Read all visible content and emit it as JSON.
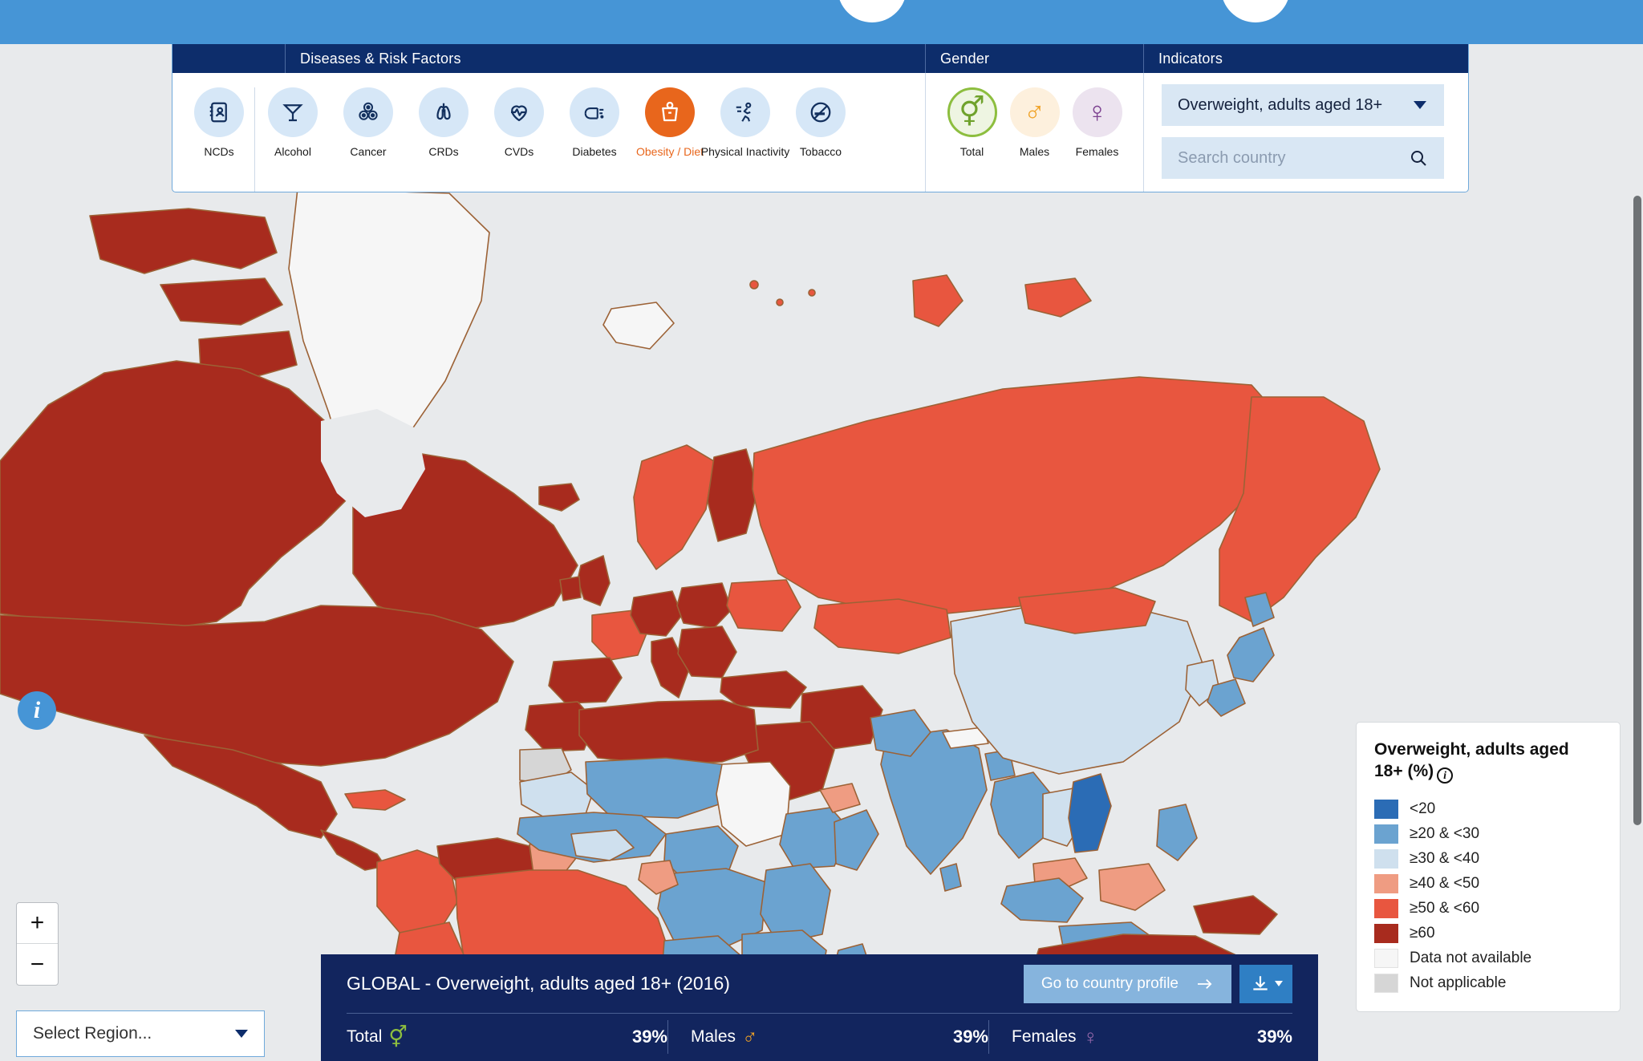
{
  "header": {
    "circles": [
      "nav-circle-left",
      "nav-circle-right"
    ]
  },
  "toolbar": {
    "sections": {
      "diseases_title": "Diseases & Risk Factors",
      "gender_title": "Gender",
      "indicators_title": "Indicators"
    },
    "ncds": {
      "label": "NCDs",
      "icon": "ncds-report-icon",
      "active": false
    },
    "risk_factors": [
      {
        "label": "Alcohol",
        "icon": "cocktail-glass-icon",
        "active": false
      },
      {
        "label": "Cancer",
        "icon": "cancer-cells-icon",
        "active": false
      },
      {
        "label": "CRDs",
        "icon": "lungs-icon",
        "active": false
      },
      {
        "label": "CVDs",
        "icon": "heart-pulse-icon",
        "active": false
      },
      {
        "label": "Diabetes",
        "icon": "finger-prick-icon",
        "active": false
      },
      {
        "label": "Obesity / Diet",
        "icon": "weight-scale-icon",
        "active": true
      },
      {
        "label": "Physical Inactivity",
        "icon": "running-person-icon",
        "active": false
      },
      {
        "label": "Tobacco",
        "icon": "no-smoking-icon",
        "active": false
      }
    ],
    "genders": [
      {
        "label": "Total",
        "icon": "total-gender-icon",
        "glyph": "⚥",
        "active": true
      },
      {
        "label": "Males",
        "icon": "male-gender-icon",
        "glyph": "♂",
        "active": false
      },
      {
        "label": "Females",
        "icon": "female-gender-icon",
        "glyph": "♀",
        "active": false
      }
    ],
    "indicator_select": {
      "value": "Overweight, adults aged 18+",
      "icon": "chevron-down-icon"
    },
    "country_search": {
      "placeholder": "Search country",
      "value": "",
      "icon": "search-icon"
    }
  },
  "map_controls": {
    "info_button": {
      "label": "i",
      "icon": "info-icon"
    },
    "zoom_in": "+",
    "zoom_out": "−",
    "region_select": {
      "value": "Select Region...",
      "icon": "chevron-down-icon"
    }
  },
  "bottom_panel": {
    "title": "GLOBAL - Overweight, adults aged 18+ (2016)",
    "profile_button": {
      "label": "Go to country profile",
      "icon": "arrow-right-icon"
    },
    "download_button": {
      "icon": "download-icon"
    },
    "stats": [
      {
        "name": "Total",
        "glyph": "⚥",
        "icon": "total-gender-icon",
        "value": "39%"
      },
      {
        "name": "Males",
        "glyph": "♂",
        "icon": "male-gender-icon",
        "value": "39%"
      },
      {
        "name": "Females",
        "glyph": "♀",
        "icon": "female-gender-icon",
        "value": "39%"
      }
    ]
  },
  "legend": {
    "title": "Overweight, adults aged 18+ (%)",
    "info_icon": "info-icon",
    "items": [
      {
        "label": "<20",
        "color": "#2b6cb5"
      },
      {
        "label": "≥20 & <30",
        "color": "#6ba3d0"
      },
      {
        "label": "≥30 & <40",
        "color": "#cfe0ee"
      },
      {
        "label": "≥40 & <50",
        "color": "#ef9c82"
      },
      {
        "label": "≥50 & <60",
        "color": "#e8563f"
      },
      {
        "label": "≥60",
        "color": "#a82b1e"
      },
      {
        "label": "Data not available",
        "color": "#f6f6f6"
      },
      {
        "label": "Not applicable",
        "color": "#d6d6d6"
      }
    ]
  },
  "chart_data": {
    "type": "map",
    "title": "GLOBAL - Overweight, adults aged 18+ (2016)",
    "indicator": "Overweight, adults aged 18+",
    "unit": "%",
    "year": 2016,
    "gender_selected": "Total",
    "global_values": {
      "Total": 39,
      "Males": 39,
      "Females": 39
    },
    "ocean_color": "#e8eaec",
    "border_color": "#9c6236",
    "bins": [
      {
        "label": "<20",
        "color": "#2b6cb5",
        "min": 0,
        "max": 20
      },
      {
        "label": "≥20 & <30",
        "color": "#6ba3d0",
        "min": 20,
        "max": 30
      },
      {
        "label": "≥30 & <40",
        "color": "#cfe0ee",
        "min": 30,
        "max": 40
      },
      {
        "label": "≥40 & <50",
        "color": "#ef9c82",
        "min": 40,
        "max": 50
      },
      {
        "label": "≥50 & <60",
        "color": "#e8563f",
        "min": 50,
        "max": 60
      },
      {
        "label": "≥60",
        "color": "#a82b1e",
        "min": 60,
        "max": 100
      },
      {
        "label": "Data not available",
        "color": "#f6f6f6"
      },
      {
        "label": "Not applicable",
        "color": "#d6d6d6"
      }
    ],
    "country_bins": {
      "United States": "≥60",
      "Canada": "≥60",
      "Mexico": "≥60",
      "Greenland": "Data not available",
      "Brazil": "≥50 & <60",
      "Argentina": "≥60",
      "Chile": "≥60",
      "Venezuela": "≥60",
      "Colombia": "≥50 & <60",
      "Peru": "≥50 & <60",
      "Bolivia": "≥50 & <60",
      "Paraguay": "≥50 & <60",
      "Uruguay": "≥60",
      "Russia": "≥50 & <60",
      "China": "≥30 & <40",
      "India": "≥20 & <30",
      "Japan": "≥20 & <30",
      "Viet Nam": "<20",
      "Australia": "≥60",
      "New Zealand": "≥60",
      "Algeria": "≥60",
      "Libya": "≥60",
      "Egypt": "≥60",
      "Saudi Arabia": "≥60",
      "Turkey": "≥60",
      "Iran": "≥60",
      "South Africa": "≥50 & <60",
      "Ethiopia": "≥20 & <30",
      "Nigeria": "≥20 & <30",
      "Sudan": "Data not available",
      "Madagascar": "≥20 & <30",
      "Namibia": "≥40 & <50",
      "Botswana": "≥40 & <50",
      "Western Sahara": "Not applicable",
      "Indonesia": "≥20 & <30",
      "Papua New Guinea": "≥60",
      "Mongolia": "≥50 & <60",
      "Kazakhstan": "≥50 & <60",
      "United Kingdom": "≥60",
      "France": "≥50 & <60",
      "Germany": "≥60",
      "Spain": "≥60",
      "Poland": "≥60",
      "Sweden": "≥50 & <60",
      "Norway": "≥50 & <60",
      "Finland": "≥60"
    }
  }
}
